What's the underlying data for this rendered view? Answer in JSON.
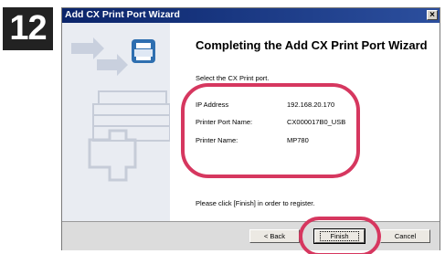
{
  "step": {
    "number": "12"
  },
  "window": {
    "title": "Add CX Print Port Wizard",
    "close_glyph": "×"
  },
  "main": {
    "heading": "Completing the Add CX Print Port Wizard",
    "subtitle": "Select the CX Print port.",
    "fields": [
      {
        "label": "IP Address",
        "value": "192.168.20.170"
      },
      {
        "label": "Printer Port Name:",
        "value": "CX000017B0_USB"
      },
      {
        "label": "Printer Name:",
        "value": "MP780"
      }
    ],
    "footer": "Please click [Finish] in order to register."
  },
  "buttons": {
    "back": "< Back",
    "finish": "Finish",
    "cancel": "Cancel"
  },
  "colors": {
    "highlight": "#d6375f",
    "titlebar": "#0a246a"
  }
}
